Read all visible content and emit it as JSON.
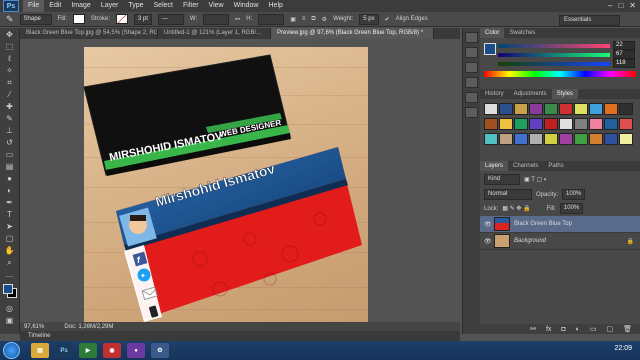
{
  "menubar": {
    "logo": "Ps",
    "items": [
      "File",
      "Edit",
      "Image",
      "Layer",
      "Type",
      "Select",
      "Filter",
      "View",
      "Window",
      "Help"
    ],
    "active_index": 0
  },
  "options": {
    "tool_mode": "Shape",
    "fill_label": "Fill:",
    "stroke_label": "Stroke:",
    "stroke_size": "3 pt",
    "w_label": "W:",
    "h_label": "H:",
    "weight_label": "Weight:",
    "weight_value": "5 px",
    "align_edges": "Align Edges",
    "workspace": "Essentials"
  },
  "tabs": [
    "Black Green Blue Top.jpg @ 54,5% (Shape 2, RGB/...",
    "Untitled-1 @ 121% (Layer 1, RGB/...",
    "Preview.jpg @ 97,6% (Black Green Blue Top, RGB/8) *"
  ],
  "active_tab": 2,
  "card_top": {
    "name": "MIRSHOHID ISMATOV",
    "role": "WEB DESIGNER"
  },
  "card_front": {
    "name": "Mirshohid Ismatov"
  },
  "status": {
    "zoom": "97,61%",
    "doc": "Doc: 1,26M/2,29M"
  },
  "timeline": {
    "label": "Timeline"
  },
  "color_panel": {
    "tabs": [
      "Color",
      "Swatches"
    ],
    "r": "22",
    "g": "67",
    "b": "118"
  },
  "styles_panel": {
    "tabs": [
      "History",
      "Adjustments",
      "Styles"
    ]
  },
  "layers_panel": {
    "tabs": [
      "Layers",
      "Channels",
      "Paths"
    ],
    "kind": "Kind",
    "blend_mode": "Normal",
    "opacity_label": "Opacity:",
    "opacity": "100%",
    "lock_label": "Lock:",
    "fill_label": "Fill:",
    "fill": "100%",
    "layers": [
      {
        "name": "Black Green Blue Top",
        "selected": true
      },
      {
        "name": "Background",
        "selected": false
      }
    ]
  },
  "taskbar": {
    "clock": "22:09"
  },
  "colors": {
    "fg": "#1a4d8a",
    "bg": "#000000",
    "accent": "#5a6a8a"
  }
}
